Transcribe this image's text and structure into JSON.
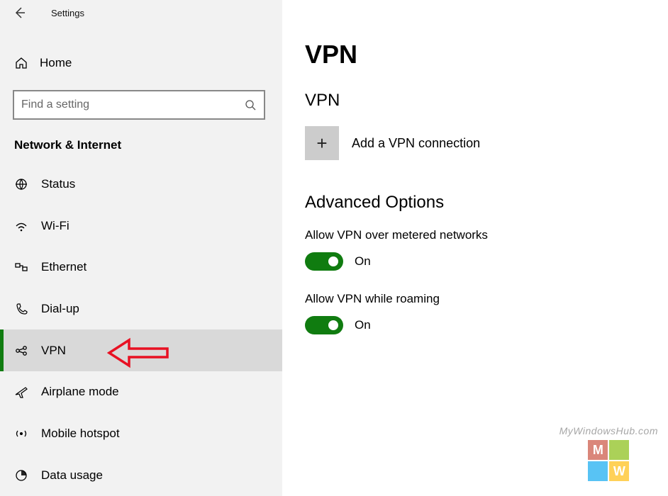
{
  "titlebar": {
    "label": "Settings"
  },
  "home": {
    "label": "Home"
  },
  "search": {
    "placeholder": "Find a setting"
  },
  "section_header": "Network & Internet",
  "nav": [
    {
      "label": "Status",
      "icon": "status-icon",
      "selected": false
    },
    {
      "label": "Wi-Fi",
      "icon": "wifi-icon",
      "selected": false
    },
    {
      "label": "Ethernet",
      "icon": "ethernet-icon",
      "selected": false
    },
    {
      "label": "Dial-up",
      "icon": "dialup-icon",
      "selected": false
    },
    {
      "label": "VPN",
      "icon": "vpn-icon",
      "selected": true
    },
    {
      "label": "Airplane mode",
      "icon": "airplane-icon",
      "selected": false
    },
    {
      "label": "Mobile hotspot",
      "icon": "hotspot-icon",
      "selected": false
    },
    {
      "label": "Data usage",
      "icon": "datausage-icon",
      "selected": false
    }
  ],
  "main": {
    "title": "VPN",
    "sub_title": "VPN",
    "add_label": "Add a VPN connection",
    "advanced_header": "Advanced Options",
    "opt1_label": "Allow VPN over metered networks",
    "opt1_state": "On",
    "opt2_label": "Allow VPN while roaming",
    "opt2_state": "On"
  },
  "watermark": {
    "text": "MyWindowsHub.com",
    "letters": [
      "M",
      "",
      "",
      "W"
    ]
  }
}
